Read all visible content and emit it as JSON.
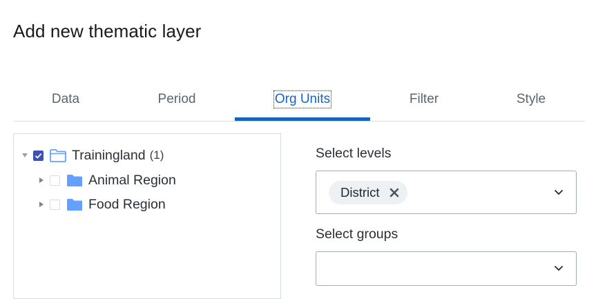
{
  "dialog": {
    "title": "Add new thematic layer"
  },
  "tabs": [
    {
      "label": "Data",
      "active": false
    },
    {
      "label": "Period",
      "active": false
    },
    {
      "label": "Org Units",
      "active": true
    },
    {
      "label": "Filter",
      "active": false
    },
    {
      "label": "Style",
      "active": false
    }
  ],
  "tree": {
    "root": {
      "label": "Trainingland",
      "count": "(1)",
      "checked": true,
      "expanded": true,
      "icon": "folder-open-icon"
    },
    "children": [
      {
        "label": "Animal Region",
        "checked": false,
        "expanded": false,
        "icon": "folder-icon"
      },
      {
        "label": "Food Region",
        "checked": false,
        "expanded": false,
        "icon": "folder-icon"
      }
    ]
  },
  "levels": {
    "label": "Select levels",
    "selected": [
      "District"
    ]
  },
  "groups": {
    "label": "Select groups",
    "selected": []
  },
  "colors": {
    "accent": "#1565c0",
    "checkbox": "#3f51b5",
    "folder": "#64a0ff"
  }
}
